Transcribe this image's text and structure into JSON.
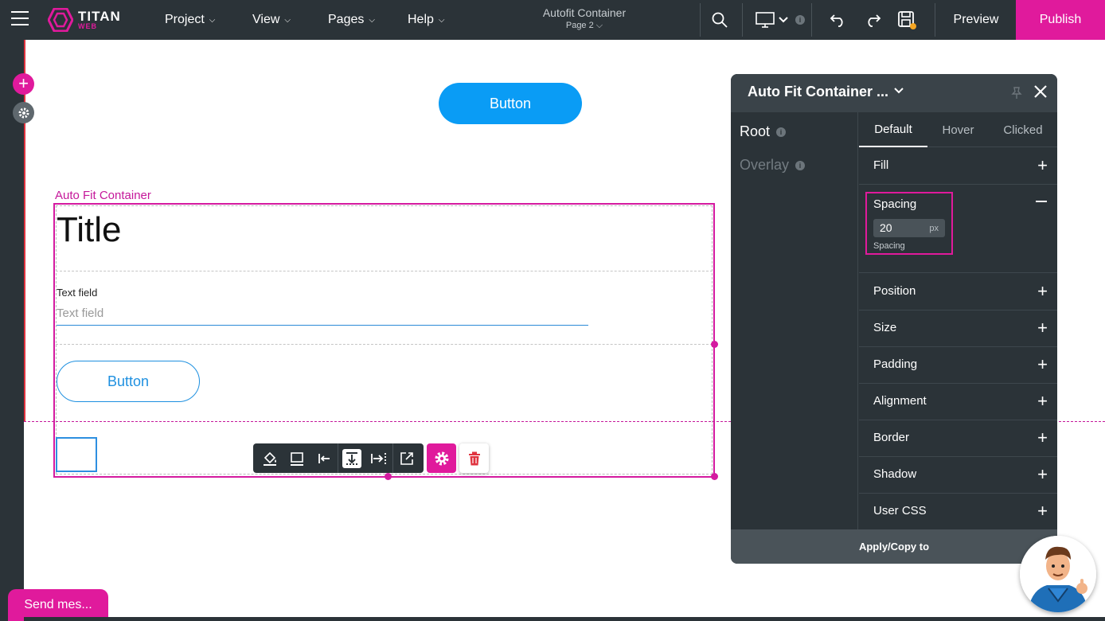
{
  "topbar": {
    "brand_top": "TITAN",
    "brand_bottom": "WEB",
    "menus": [
      {
        "label": "Project"
      },
      {
        "label": "View"
      },
      {
        "label": "Pages"
      },
      {
        "label": "Help"
      }
    ],
    "page_title": "Autofit Container",
    "page_sub": "Page 2",
    "device_badge": "i",
    "preview_label": "Preview",
    "publish_label": "Publish",
    "accent": "#e01a9c"
  },
  "sidebar": {
    "add_symbol": "+"
  },
  "canvas": {
    "top_button": "Button",
    "container_label": "Auto Fit Container",
    "title": "Title",
    "text_field_label": "Text field",
    "text_field_placeholder": "Text field",
    "outline_button": "Button"
  },
  "panel": {
    "title": "Auto Fit Container ...",
    "sides": [
      {
        "label": "Root",
        "badge": "i"
      },
      {
        "label": "Overlay",
        "badge": "i"
      }
    ],
    "tabs": [
      {
        "label": "Default"
      },
      {
        "label": "Hover"
      },
      {
        "label": "Clicked"
      }
    ],
    "fill_label": "Fill",
    "spacing": {
      "label": "Spacing",
      "value": "20",
      "unit": "px",
      "caption": "Spacing"
    },
    "rows": [
      {
        "label": "Position"
      },
      {
        "label": "Size"
      },
      {
        "label": "Padding"
      },
      {
        "label": "Alignment"
      },
      {
        "label": "Border"
      },
      {
        "label": "Shadow"
      },
      {
        "label": "User CSS"
      }
    ],
    "footer": "Apply/Copy to"
  },
  "chat": {
    "send_label": "Send mes..."
  }
}
